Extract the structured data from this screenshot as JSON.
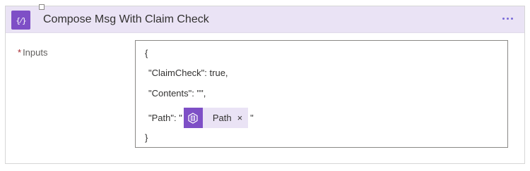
{
  "card": {
    "title": "Compose Msg With Claim Check",
    "more_icon": "ellipsis-icon",
    "header_icon": "compose-curly-braces-icon",
    "accent_color": "#7e4fc6",
    "header_bg": "#eae3f5"
  },
  "field": {
    "required_marker": "*",
    "label": "Inputs"
  },
  "editor": {
    "open_brace": "{",
    "line_claimcheck": "\"ClaimCheck\": true,",
    "line_contents": "\"Contents\": \"\",",
    "path_key": "\"Path\": \"",
    "path_end_quote": "\"",
    "close_brace": "}",
    "token": {
      "label": "Path",
      "close": "×",
      "icon": "dynamic-content-icon"
    }
  }
}
